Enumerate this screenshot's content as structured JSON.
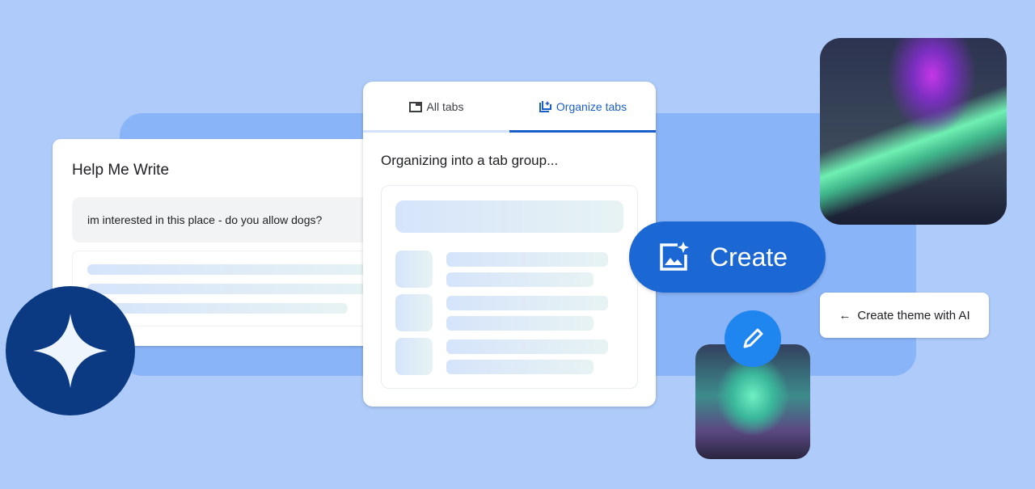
{
  "help_me_write": {
    "title": "Help Me Write",
    "prompt": "im interested in this place - do you allow dogs?"
  },
  "tabs_panel": {
    "tabs": [
      {
        "label": "All tabs",
        "icon": "tab-icon"
      },
      {
        "label": "Organize tabs",
        "icon": "organize-tabs-icon",
        "active": true
      }
    ],
    "status": "Organizing into a tab group..."
  },
  "create_button": {
    "label": "Create",
    "icon": "image-sparkle-icon"
  },
  "theme_button": {
    "label": "Create theme with AI",
    "icon": "arrow-left-icon"
  },
  "colors": {
    "accent": "#1b67d3",
    "background": "#aecbfa",
    "panel": "#8ab4f8",
    "sparkle_badge": "#0b3a82"
  }
}
